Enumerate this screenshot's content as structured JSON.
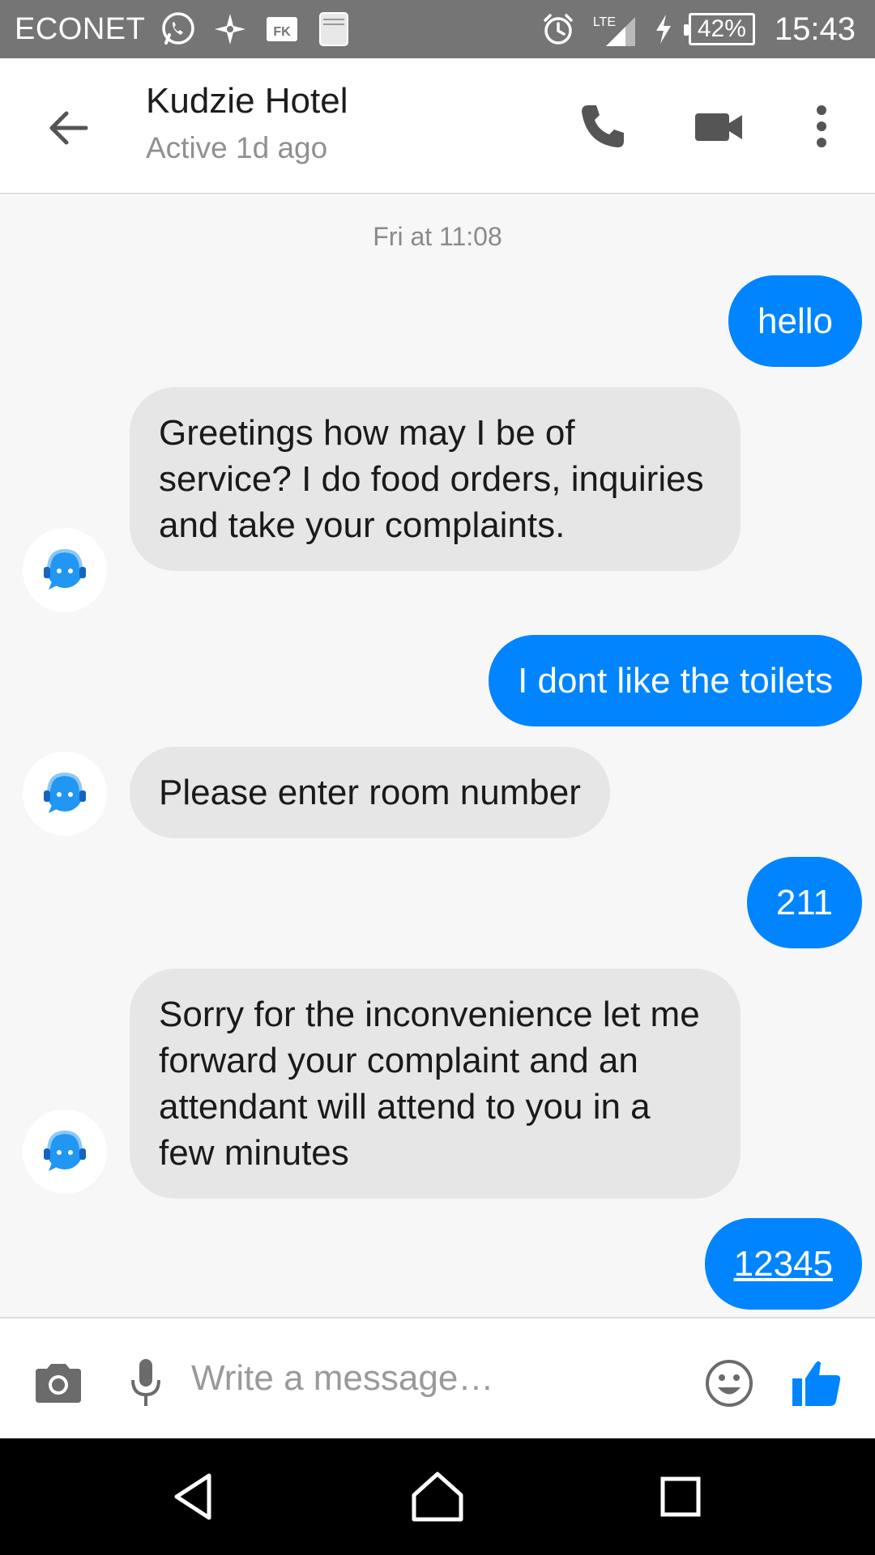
{
  "status_bar": {
    "carrier": "ECONET",
    "network_label": "LTE",
    "battery": "42%",
    "time": "15:43",
    "icons": [
      "whatsapp-icon",
      "pinwheel-icon",
      "fk-app-icon",
      "holy-bible-icon",
      "alarm-icon",
      "signal-icon",
      "charging-icon",
      "battery-icon"
    ]
  },
  "header": {
    "contact_name": "Kudzie Hotel",
    "contact_status": "Active 1d ago",
    "icons": [
      "back-arrow-icon",
      "phone-icon",
      "video-camera-icon",
      "more-vert-icon"
    ]
  },
  "conversation": {
    "timestamp": "Fri at 11:08",
    "messages": [
      {
        "from": "me",
        "text": "hello"
      },
      {
        "from": "bot",
        "text": "Greetings how may I be of service? I do food orders, inquiries and take your complaints."
      },
      {
        "from": "me",
        "text": "I dont like the toilets"
      },
      {
        "from": "bot",
        "text": "Please enter room number"
      },
      {
        "from": "me",
        "text": "211"
      },
      {
        "from": "bot",
        "text": "Sorry for the inconvenience let me forward your complaint and an attendant will attend to you in a few minutes"
      },
      {
        "from": "me",
        "text": "12345",
        "link": true
      }
    ]
  },
  "composer": {
    "placeholder": "Write a message…",
    "value": "",
    "icons": [
      "camera-icon",
      "microphone-icon",
      "emoji-icon",
      "thumbs-up-icon"
    ]
  },
  "nav_bar": {
    "icons": [
      "nav-back-icon",
      "nav-home-icon",
      "nav-recents-icon"
    ]
  },
  "colors": {
    "status_bar": "#757575",
    "accent": "#0084ff",
    "incoming_bubble": "#e6e6e6",
    "background": "#f7f7f7"
  }
}
